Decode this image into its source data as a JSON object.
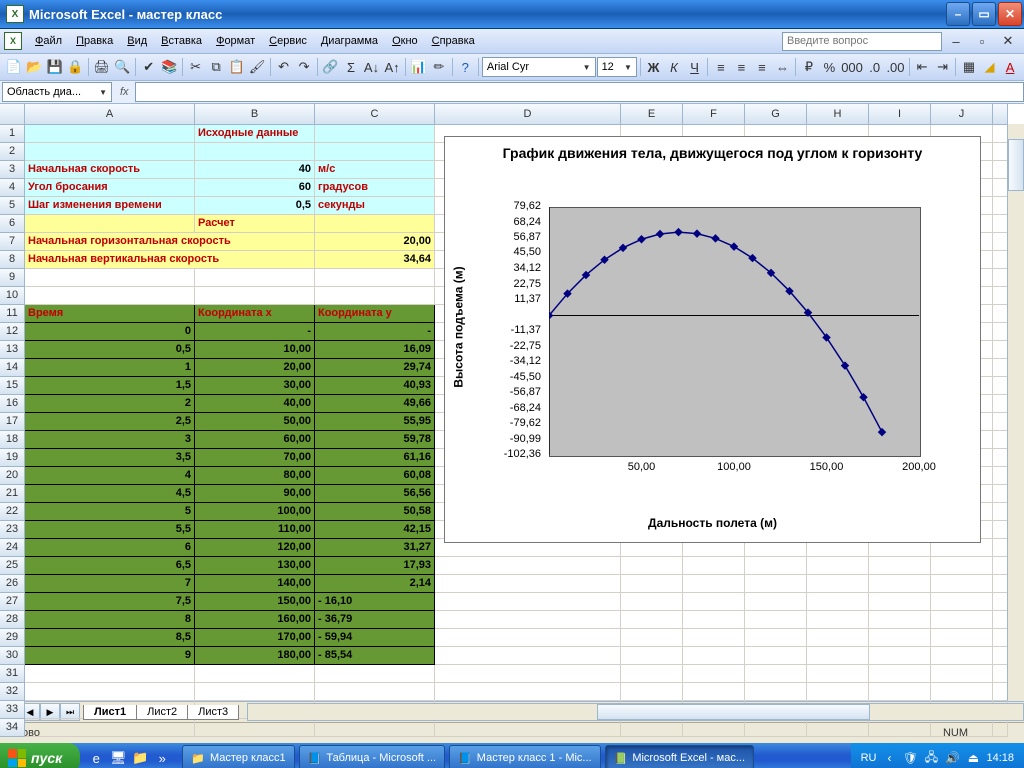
{
  "window": {
    "title": "Microsoft Excel - мастер класс"
  },
  "menu": {
    "items": [
      "Файл",
      "Правка",
      "Вид",
      "Вставка",
      "Формат",
      "Сервис",
      "Диаграмма",
      "Окно",
      "Справка"
    ],
    "question_placeholder": "Введите вопрос"
  },
  "formatting": {
    "font": "Arial Cyr",
    "size": "12"
  },
  "namebox": "Область диа...",
  "columns": [
    "A",
    "B",
    "C",
    "D",
    "E",
    "F",
    "G",
    "H",
    "I",
    "J"
  ],
  "sheet_tabs": [
    "Лист1",
    "Лист2",
    "Лист3"
  ],
  "status": {
    "ready": "Готово",
    "num": "NUM"
  },
  "sections": {
    "input_header": "Исходные данные",
    "calc_header": "Расчет",
    "v0": {
      "label": "Начальная скорость",
      "val": "40",
      "unit": "м/с"
    },
    "angle": {
      "label": "Угол бросания",
      "val": "60",
      "unit": "градусов"
    },
    "dt": {
      "label": "Шаг изменения времени",
      "val": "0,5",
      "unit": "секунды"
    },
    "vx": {
      "label": "Начальная горизонтальная скорость",
      "val": "20,00"
    },
    "vy": {
      "label": "Начальная вертикальная скорость",
      "val": "34,64"
    },
    "col_t": "Время",
    "col_x": "Координата x",
    "col_y": "Координата y"
  },
  "data_rows": [
    {
      "t": "0",
      "x": "-",
      "y": "-"
    },
    {
      "t": "0,5",
      "x": "10,00",
      "y": "16,09"
    },
    {
      "t": "1",
      "x": "20,00",
      "y": "29,74"
    },
    {
      "t": "1,5",
      "x": "30,00",
      "y": "40,93"
    },
    {
      "t": "2",
      "x": "40,00",
      "y": "49,66"
    },
    {
      "t": "2,5",
      "x": "50,00",
      "y": "55,95"
    },
    {
      "t": "3",
      "x": "60,00",
      "y": "59,78"
    },
    {
      "t": "3,5",
      "x": "70,00",
      "y": "61,16"
    },
    {
      "t": "4",
      "x": "80,00",
      "y": "60,08"
    },
    {
      "t": "4,5",
      "x": "90,00",
      "y": "56,56"
    },
    {
      "t": "5",
      "x": "100,00",
      "y": "50,58"
    },
    {
      "t": "5,5",
      "x": "110,00",
      "y": "42,15"
    },
    {
      "t": "6",
      "x": "120,00",
      "y": "31,27"
    },
    {
      "t": "6,5",
      "x": "130,00",
      "y": "17,93"
    },
    {
      "t": "7",
      "x": "140,00",
      "y": "2,14"
    },
    {
      "t": "7,5",
      "x": "150,00",
      "y": "16,10",
      "neg": true
    },
    {
      "t": "8",
      "x": "160,00",
      "y": "36,79",
      "neg": true
    },
    {
      "t": "8,5",
      "x": "170,00",
      "y": "59,94",
      "neg": true
    },
    {
      "t": "9",
      "x": "180,00",
      "y": "85,54",
      "neg": true
    }
  ],
  "chart_data": {
    "type": "line",
    "title": "График движения тела, движущегося под углом к горизонту",
    "xlabel": "Дальность полета (м)",
    "ylabel": "Высота подъема (м)",
    "xlim": [
      0,
      200
    ],
    "ylim": [
      -102.36,
      79.62
    ],
    "yticks": [
      79.62,
      68.24,
      56.87,
      45.5,
      34.12,
      22.75,
      11.37,
      -11.37,
      -22.75,
      -34.12,
      -45.5,
      -56.87,
      -68.24,
      -79.62,
      -90.99,
      -102.36
    ],
    "xticks": [
      50,
      100,
      150,
      200
    ],
    "x": [
      0,
      10,
      20,
      30,
      40,
      50,
      60,
      70,
      80,
      90,
      100,
      110,
      120,
      130,
      140,
      150,
      160,
      170,
      180
    ],
    "y": [
      0,
      16.09,
      29.74,
      40.93,
      49.66,
      55.95,
      59.78,
      61.16,
      60.08,
      56.56,
      50.58,
      42.15,
      31.27,
      17.93,
      2.14,
      -16.1,
      -36.79,
      -59.94,
      -85.54
    ]
  },
  "taskbar": {
    "start": "пуск",
    "tasks": [
      {
        "icon": "📁",
        "label": "Мастер класс1"
      },
      {
        "icon": "📘",
        "label": "Таблица - Microsoft ..."
      },
      {
        "icon": "📘",
        "label": "Мастер класс 1 - Mic..."
      },
      {
        "icon": "📗",
        "label": "Microsoft Excel - мас...",
        "active": true
      }
    ],
    "lang": "RU",
    "time": "14:18"
  }
}
